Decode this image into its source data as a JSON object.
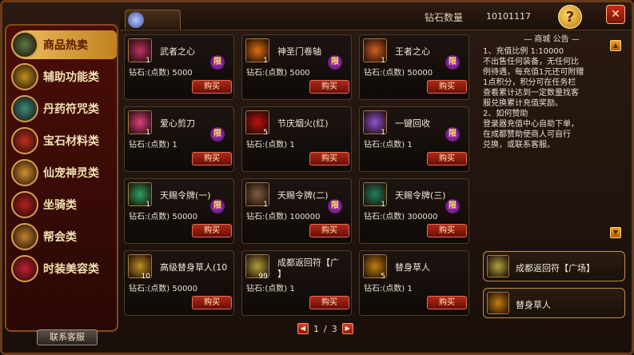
{
  "header": {
    "diamond_label": "钻石数量",
    "diamond_value": "10101117",
    "help_symbol": "?"
  },
  "sidebar": {
    "items": [
      {
        "label": "商品热卖",
        "icon": "hot-sale-icon",
        "active": true
      },
      {
        "label": "辅助功能类",
        "icon": "auxiliary-icon",
        "active": false
      },
      {
        "label": "丹药符咒类",
        "icon": "elixir-icon",
        "active": false
      },
      {
        "label": "宝石材料类",
        "icon": "gem-icon",
        "active": false
      },
      {
        "label": "仙宠神灵类",
        "icon": "pet-icon",
        "active": false
      },
      {
        "label": "坐骑类",
        "icon": "mount-icon",
        "active": false
      },
      {
        "label": "帮会类",
        "icon": "guild-icon",
        "active": false
      },
      {
        "label": "时装美容类",
        "icon": "fashion-icon",
        "active": false
      }
    ],
    "contact_label": "联系客服"
  },
  "products": [
    {
      "name": "武者之心",
      "qty": "1",
      "price": "钻石:(点数) 5000",
      "limited": true,
      "limit_label": "限",
      "buy": "购买",
      "color": "#c0306a"
    },
    {
      "name": "神圣门卷轴",
      "qty": "1",
      "price": "钻石:(点数) 5000",
      "limited": true,
      "limit_label": "限",
      "buy": "购买",
      "color": "#e07010"
    },
    {
      "name": "王者之心",
      "qty": "1",
      "price": "钻石:(点数) 50000",
      "limited": true,
      "limit_label": "限",
      "buy": "购买",
      "color": "#d06020"
    },
    {
      "name": "爱心剪刀",
      "qty": "1",
      "price": "钻石:(点数) 1",
      "limited": true,
      "limit_label": "限",
      "buy": "购买",
      "color": "#e04080"
    },
    {
      "name": "节庆烟火(红)",
      "qty": "5",
      "price": "钻石:(点数) 1",
      "limited": false,
      "limit_label": "",
      "buy": "购买",
      "color": "#c01010"
    },
    {
      "name": "一键回收",
      "qty": "1",
      "price": "钻石:(点数) 1",
      "limited": true,
      "limit_label": "限",
      "buy": "购买",
      "color": "#9050d0"
    },
    {
      "name": "天赐令牌(一)",
      "qty": "1",
      "price": "钻石:(点数) 50000",
      "limited": true,
      "limit_label": "限",
      "buy": "购买",
      "color": "#30a060"
    },
    {
      "name": "天赐令牌(二)",
      "qty": "1",
      "price": "钻石:(点数) 100000",
      "limited": true,
      "limit_label": "限",
      "buy": "购买",
      "color": "#806040"
    },
    {
      "name": "天赐令牌(三)",
      "qty": "1",
      "price": "钻石:(点数) 300000",
      "limited": true,
      "limit_label": "限",
      "buy": "购买",
      "color": "#208060"
    },
    {
      "name": "高级替身草人(10",
      "qty": "10",
      "price": "钻石:(点数) 50000",
      "limited": false,
      "limit_label": "",
      "buy": "购买",
      "color": "#c09020"
    },
    {
      "name": "成都返回符【广",
      "name2": "】",
      "qty": "99",
      "price": "钻石:(点数) 1",
      "limited": false,
      "limit_label": "",
      "buy": "购买",
      "color": "#b0a040"
    },
    {
      "name": "替身草人",
      "qty": "5",
      "price": "钻石:(点数) 1",
      "limited": false,
      "limit_label": "",
      "buy": "购买",
      "color": "#c08010"
    }
  ],
  "notice": {
    "title": "— 商城 公告 —",
    "lines": [
      "1、充值比例 1:10000",
      "不出售任何装备，无任何比",
      "例待遇，每充值1元还可附赠",
      "1点积分，积分可在任务栏",
      "查看累计达到一定数量找客",
      "服兑换累计充值奖励。",
      "2、如何赞助",
      "登录器充值中心自助下单，",
      "在成都赞助使商人可自行",
      "兑换，或联系客服。"
    ]
  },
  "recommendations": [
    {
      "name": "成都返回符【广场】",
      "color": "#b0a040"
    },
    {
      "name": "替身草人",
      "color": "#c08010"
    }
  ],
  "pager": {
    "current": "1",
    "separator": "/",
    "total": "3"
  }
}
